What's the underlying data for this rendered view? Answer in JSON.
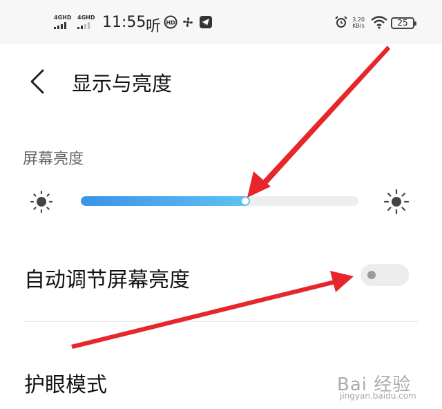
{
  "status_bar": {
    "sim1_tag": "4GHD",
    "sim2_tag": "4GHD",
    "time": "11:55",
    "ting_glyph": "听",
    "network_speed_value": "3.20",
    "network_speed_unit": "KB/s",
    "battery_level": "25",
    "icons": [
      "signal-icon",
      "signal-icon",
      "listen-icon",
      "hd-icon",
      "fan-icon",
      "telegram-icon",
      "alarm-icon",
      "wifi-icon",
      "battery-icon"
    ]
  },
  "header": {
    "back_icon": "chevron-left-icon",
    "title": "显示与亮度"
  },
  "brightness": {
    "section_label": "屏幕亮度",
    "level_fraction": 0.61,
    "min_icon": "sun-dim-icon",
    "max_icon": "sun-bright-icon",
    "fill_colors": [
      "#3b93e8",
      "#5fc2f4"
    ]
  },
  "auto_brightness": {
    "label": "自动调节屏幕亮度",
    "enabled": false
  },
  "eye_protection": {
    "label": "护眼模式"
  },
  "watermark": {
    "text": "Bai 经验",
    "url": "jingyan.baidu.com"
  },
  "annotation_color": "#e6262a"
}
